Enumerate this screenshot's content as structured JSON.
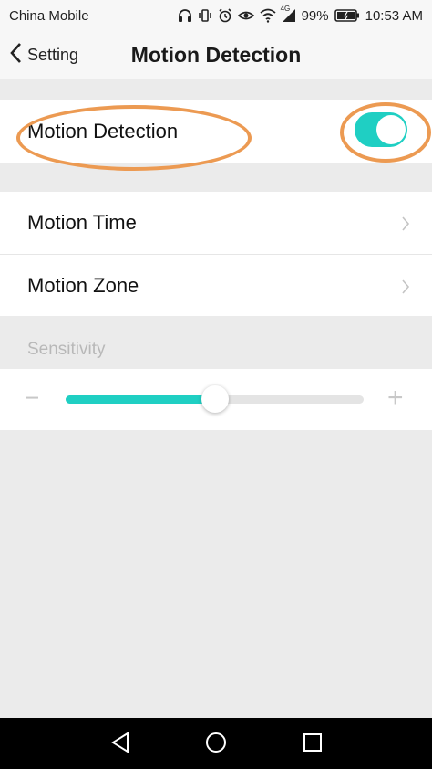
{
  "status_bar": {
    "carrier": "China Mobile",
    "network": "4G",
    "battery": "99%",
    "time": "10:53 AM",
    "icons": [
      "headset-icon",
      "vibrate-icon",
      "alarm-icon",
      "eye-icon",
      "wifi-icon",
      "signal-icon",
      "battery-icon"
    ]
  },
  "header": {
    "back_label": "Setting",
    "title": "Motion Detection"
  },
  "settings": {
    "motion_detection": {
      "label": "Motion Detection",
      "enabled": true
    },
    "motion_time": {
      "label": "Motion Time"
    },
    "motion_zone": {
      "label": "Motion Zone"
    }
  },
  "sensitivity": {
    "label": "Sensitivity",
    "minus": "−",
    "plus": "+",
    "value": 0.5
  },
  "colors": {
    "accent": "#1fcfc3",
    "annotation": "#ec9a52",
    "background": "#ebebeb"
  },
  "nav_bar": {
    "icons": [
      "back-triangle-icon",
      "home-circle-icon",
      "recents-square-icon"
    ]
  }
}
